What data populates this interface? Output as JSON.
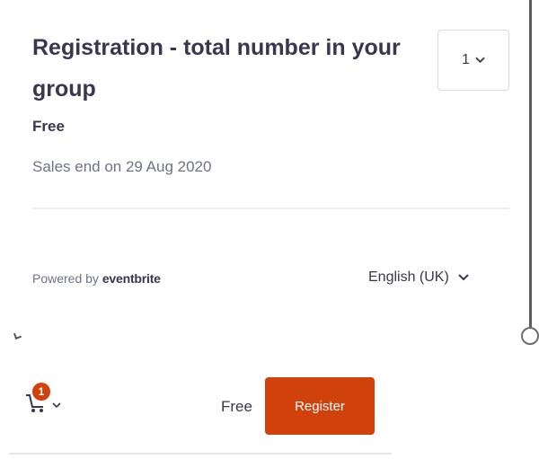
{
  "ticket": {
    "title": "Registration - total number in your group",
    "price": "Free",
    "sales_end": "Sales end on 29 Aug 2020",
    "quantity": "1"
  },
  "footer": {
    "powered_prefix": "Powered by",
    "brand": "eventbrite",
    "language": "English (UK)"
  },
  "checkout": {
    "cart_count": "1",
    "total": "Free",
    "register_label": "Register"
  },
  "colors": {
    "accent": "#d1410c",
    "text": "#39364f",
    "muted": "#6f7287"
  },
  "icons": [
    "chevron-down-icon",
    "cart-icon"
  ]
}
